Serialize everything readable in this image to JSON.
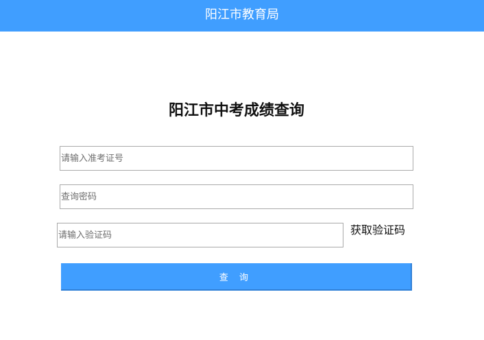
{
  "header": {
    "title": "阳江市教育局"
  },
  "form": {
    "title": "阳江市中考成绩查询",
    "exam_no_placeholder": "请输入准考证号",
    "password_placeholder": "查询密码",
    "captcha_placeholder": "请输入验证码",
    "get_captcha_label": "获取验证码",
    "submit_label": "查 询"
  },
  "colors": {
    "accent": "#409eff"
  }
}
